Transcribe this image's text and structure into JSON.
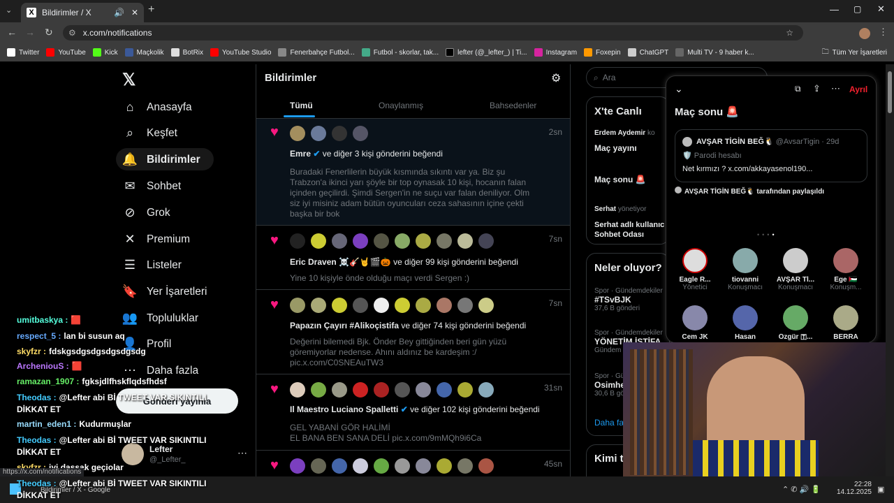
{
  "browser": {
    "tab_title": "Bildirimler / X",
    "url": "x.com/notifications",
    "bookmarks": [
      "Twitter",
      "YouTube",
      "Kick",
      "Maçkolik",
      "BotRix",
      "YouTube Studio",
      "Fenerbahçe Futbol...",
      "Futbol - skorlar, tak...",
      "lefter (@_lefter_) | Ti...",
      "Instagram",
      "Foxepin",
      "ChatGPT",
      "Multi TV - 9 haber k..."
    ],
    "all_bookmarks": "Tüm Yer İşaretleri",
    "status_url": "https://x.com/notifications"
  },
  "nav": {
    "items": [
      "Anasayfa",
      "Keşfet",
      "Bildirimler",
      "Sohbet",
      "Grok",
      "Premium",
      "Listeler",
      "Yer İşaretleri",
      "Topluluklar",
      "Profil",
      "Daha fazla"
    ],
    "post_button": "Gönderi yayınla",
    "user_name": "Lefter",
    "user_handle": "@_Lefter_"
  },
  "main": {
    "title": "Bildirimler",
    "tabs": [
      "Tümü",
      "Onaylanmış",
      "Bahsedenler"
    ],
    "notifications": [
      {
        "time": "2sn",
        "who": "Emre",
        "rest": "ve diğer 3 kişi gönderini beğendi",
        "body": "Buradaki Fenerlilerin büyük kısmında sıkıntı var ya. Biz şu Trabzon'a ikinci yarı şöyle bir top oynasak 10 kişi, hocanın falan içinden geçilirdi. Şimdi Sergen'in ne suçu var falan deniliyor. Olm siz iyi misiniz adam bütün oyuncuları ceza sahasının içine çekti başka bir bok"
      },
      {
        "time": "7sn",
        "who": "Eric Draven ☠️🎸🤘🎬🎃",
        "rest": "ve diğer 99 kişi gönderini beğendi",
        "body": "Yine 10 kişiyle önde olduğu maçı verdi Sergen :)"
      },
      {
        "time": "7sn",
        "who": "Papazın Çayırı #Alikoçistifa",
        "rest": "ve diğer 74 kişi gönderini beğendi",
        "body": "Değerini bilemedi Bjk. Önder Bey gittiğinden beri gün yüzü göremiyorlar nedense. Ahını aldınız be kardeşim :/ pic.x.com/C0SNEAuTW3"
      },
      {
        "time": "31sn",
        "who": "Il Maestro Luciano Spalletti",
        "rest": "ve diğer 102 kişi gönderini beğendi",
        "body": "GEL YABANİ GÖR HALİMİ\nEL BANA BEN SANA DELİ pic.x.com/9mMQh9i6Ca"
      },
      {
        "time": "45sn",
        "who": "",
        "rest": "",
        "body": ""
      }
    ]
  },
  "right": {
    "search_placeholder": "Ara",
    "live_title": "X'te Canlı",
    "live_host": "Erdem Aydemir",
    "live_host_role": "ko",
    "live_1": "Maç yayını",
    "live_2": "Maç sonu 🚨",
    "live_3_host": "Serhat",
    "live_3_role": "yönetiyor",
    "live_3_title": "Serhat adlı kullanıc Sohbet Odası",
    "trends_title": "Neler oluyor?",
    "trends": [
      {
        "meta": "Spor · Gündemdekiler",
        "name": "#TSvBJK",
        "count": "37,6 B gönderi"
      },
      {
        "meta": "Spor · Gündemdekiler",
        "name": "YÖNETİM İSTİFA",
        "count": "Gündem"
      },
      {
        "meta": "Spor · Gündemdekiler",
        "name": "Osimhe",
        "count": "30,6 B gönderi"
      }
    ],
    "more": "Daha fa",
    "who_follow": "Kimi t"
  },
  "spaces": {
    "leave": "Ayrıl",
    "title": "Maç sonu 🚨",
    "post_user": "AVŞAR TİGİN BEĞ🐧",
    "post_handle": "@AvsarTigin · 29d",
    "post_badge": "🛡️ Parodi hesabı",
    "post_text": "Net kırmızı ? x.com/akkayasenol190...",
    "shared_by": "AVŞAR TİGİN BEĞ🐧 tarafından paylaşıldı",
    "participants": [
      {
        "name": "Eagle R...",
        "role": "Yönetici",
        "color": "#c0c0c0"
      },
      {
        "name": "tiovanni",
        "role": "Konuşmacı",
        "color": "#8aa"
      },
      {
        "name": "AVŞAR Tİ...",
        "role": "Konuşmacı",
        "color": "#ddd"
      },
      {
        "name": "Ege 🇵🇸",
        "role": "Konuşm...",
        "color": "#a66"
      },
      {
        "name": "Cem JK",
        "role": "",
        "color": "#88a"
      },
      {
        "name": "Hasan",
        "role": "",
        "color": "#56a"
      },
      {
        "name": "Özgür 🇹...",
        "role": "",
        "color": "#6a6"
      },
      {
        "name": "BERRA",
        "role": "",
        "color": "#aa8"
      }
    ]
  },
  "chat": [
    {
      "u": "umitbaskya :",
      "m": "🟥"
    },
    {
      "u": "respect_5 :",
      "m": "lan bi susun aq"
    },
    {
      "u": "skyfzr :",
      "m": "fdskgsdgsdgsdgsdgsdg"
    },
    {
      "u": "ArcheniouS :",
      "m": "🟥"
    },
    {
      "u": "ramazan_1907 :",
      "m": "fgksjdlfhskflqdsfhdsf"
    },
    {
      "u": "Theodas :",
      "m": "@Lefter abi Bİ TWEET VAR SIKINTILI DİKKAT ET"
    },
    {
      "u": "martin_eden1 :",
      "m": "Kudurmuşlar"
    },
    {
      "u": "Theodas :",
      "m": "@Lefter abi Bİ TWEET VAR SIKINTILI DİKKAT ET"
    },
    {
      "u": "skyfzr :",
      "m": "iyi daşşak geçiolar"
    },
    {
      "u": "Theodas :",
      "m": "@Lefter abi Bİ TWEET VAR SIKINTILI DİKKAT ET"
    }
  ],
  "taskbar": {
    "window": "Bildirimler / X - Google",
    "time": "22:28",
    "date": "14.12.2025"
  }
}
